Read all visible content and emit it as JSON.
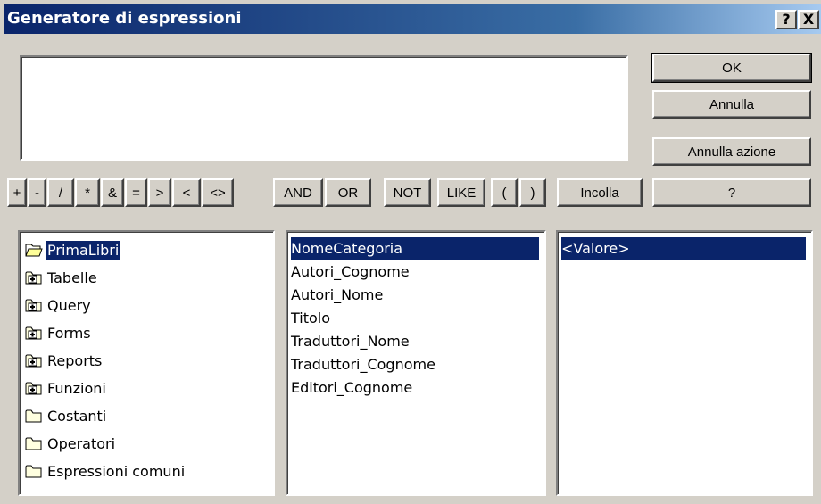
{
  "window": {
    "title": "Generatore di espressioni",
    "help_glyph": "?",
    "close_glyph": "X"
  },
  "expression_box": {
    "value": ""
  },
  "buttons": {
    "ok": "OK",
    "annulla": "Annulla",
    "annulla_azione": "Annulla azione",
    "incolla": "Incolla",
    "help": "?"
  },
  "operators": [
    "+",
    "-",
    "/",
    "*",
    "&",
    "=",
    ">",
    "<",
    "<>",
    "AND",
    "OR",
    "NOT",
    "LIKE",
    "(",
    ")"
  ],
  "tree": {
    "items": [
      {
        "label": "PrimaLibri",
        "icon": "open-folder-icon",
        "selected": true
      },
      {
        "label": "Tabelle",
        "icon": "plus-folder-icon"
      },
      {
        "label": "Query",
        "icon": "plus-folder-icon"
      },
      {
        "label": "Forms",
        "icon": "plus-folder-icon"
      },
      {
        "label": "Reports",
        "icon": "plus-folder-icon"
      },
      {
        "label": "Funzioni",
        "icon": "plus-folder-icon"
      },
      {
        "label": "Costanti",
        "icon": "folder-icon"
      },
      {
        "label": "Operatori",
        "icon": "folder-icon"
      },
      {
        "label": "Espressioni comuni",
        "icon": "folder-icon"
      }
    ]
  },
  "fields": {
    "items": [
      "NomeCategoria",
      "Autori_Cognome",
      "Autori_Nome",
      "Titolo",
      "Traduttori_Nome",
      "Traduttori_Cognome",
      "Editori_Cognome"
    ],
    "selected_index": 0
  },
  "values": {
    "items": [
      "<Valore>"
    ],
    "selected_index": 0
  },
  "colors": {
    "selection": "#0a246a",
    "dialog_bg": "#d4d0c8",
    "titlebar": "#0a246a"
  }
}
